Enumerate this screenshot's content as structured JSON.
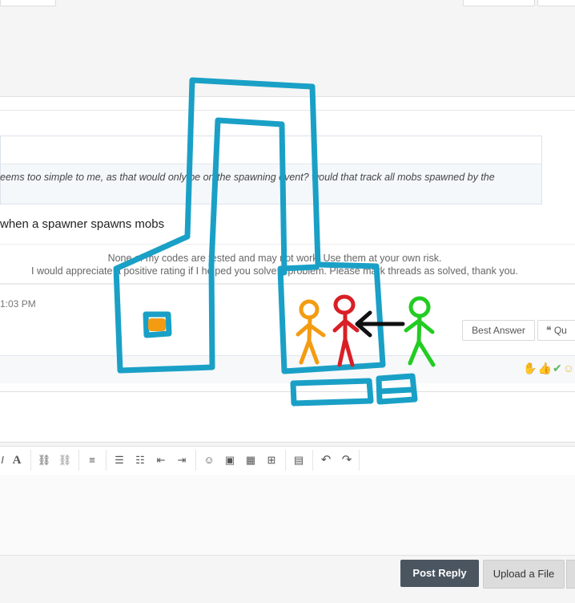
{
  "quote": {
    "text": "eems too simple to me, as that would only be on the spawning event? would that track all mobs spawned by the"
  },
  "post": {
    "text": "when a spawner spawns mobs",
    "signature_line1": "None of my codes are tested and may not work. Use them at your own risk.",
    "signature_line2": "I would appreciate a positive rating if I helped you solve a problem. Please mark threads as solved, thank you.",
    "time": "1:03 PM"
  },
  "post_actions": {
    "best_answer_label": "Best Answer",
    "quote_label": "Qu"
  },
  "reactions": {
    "icons": [
      "dislike-icon",
      "thumbs-up-icon",
      "check-icon",
      "smile-icon"
    ]
  },
  "toolbar": {
    "icons": [
      "italic-icon",
      "font-icon",
      "link-icon",
      "unlink-icon",
      "align-left-icon",
      "bullet-list-icon",
      "numbered-list-icon",
      "outdent-icon",
      "indent-icon",
      "smiley-icon",
      "image-icon",
      "media-icon",
      "insert-icon",
      "save-icon",
      "undo-icon",
      "redo-icon"
    ],
    "glyphs": {
      "italic": "I",
      "font": "A",
      "link": "⛓",
      "unlink": "⛓",
      "align": "≡",
      "bullets": "☰",
      "numbers": "☷",
      "outdent": "⇤",
      "indent": "⇥",
      "smiley": "☺",
      "image": "▣",
      "media": "▦",
      "insert": "⊞",
      "save": "▤",
      "undo": "↶",
      "redo": "↷"
    }
  },
  "buttons": {
    "post_reply": "Post Reply",
    "upload_file": "Upload a File"
  },
  "colors": {
    "annotation_blue": "#1aa0c6",
    "orange_figure": "#f39c12",
    "red_figure": "#d91f26",
    "green_figure": "#22cc22",
    "arrow": "#111111",
    "post_reply_bg": "#4a5560"
  }
}
